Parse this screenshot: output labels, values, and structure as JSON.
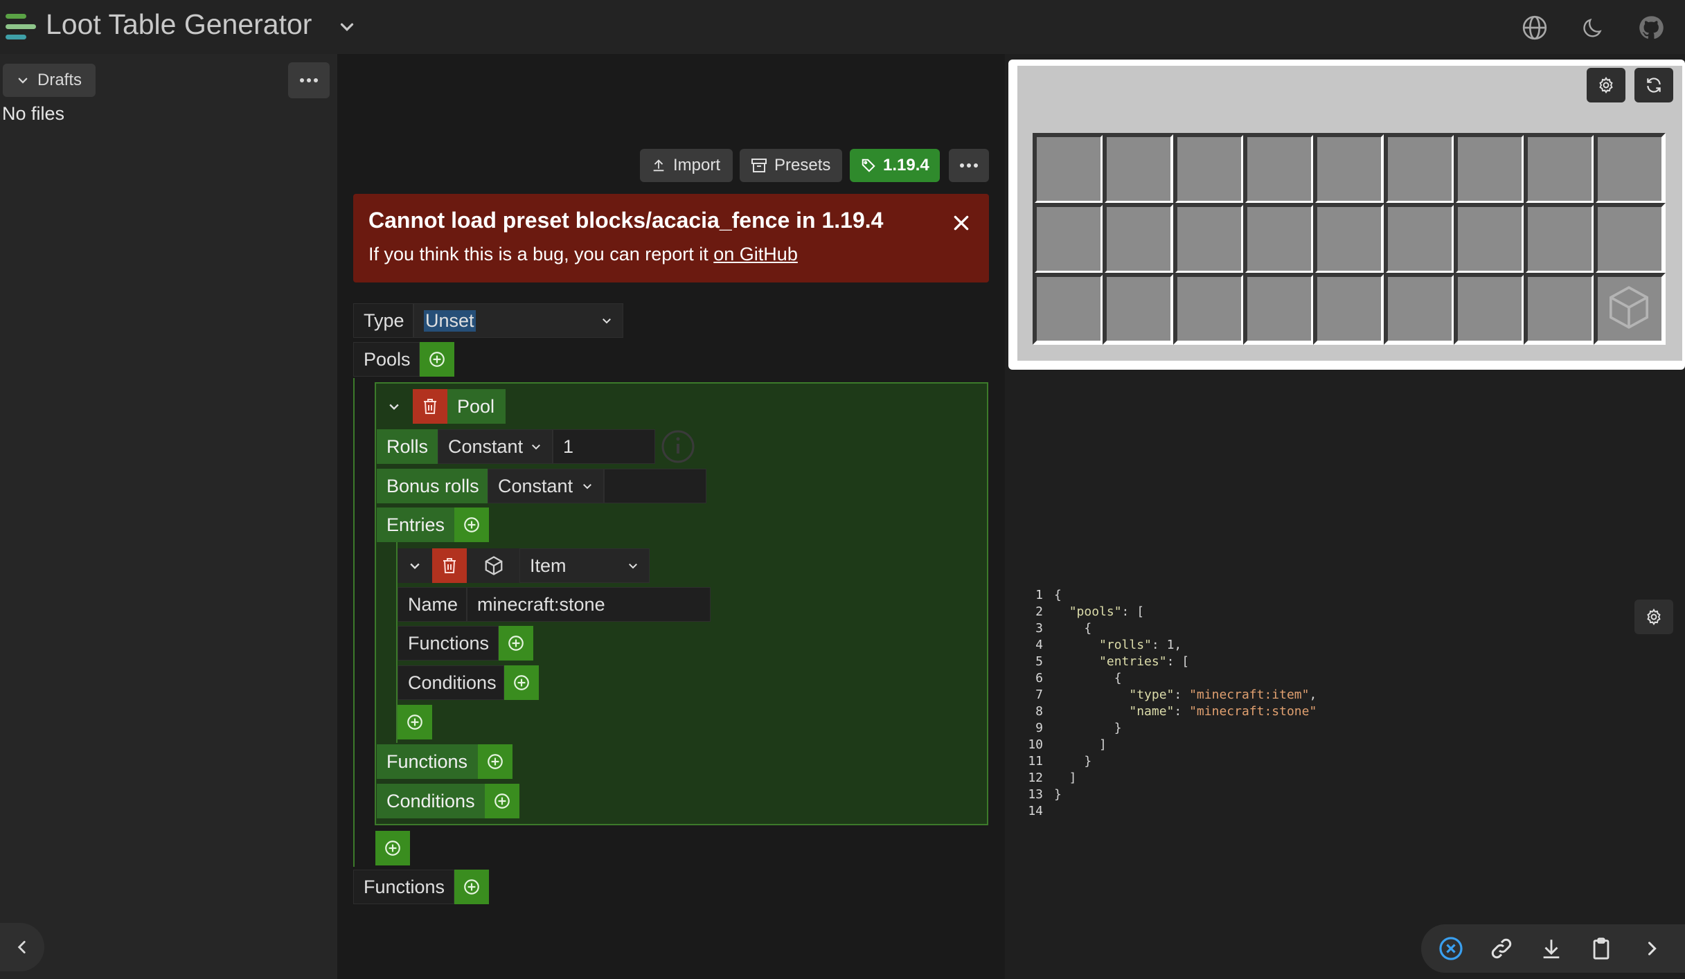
{
  "header": {
    "title": "Loot Table Generator",
    "icons": {
      "logo": "logo-bars-icon",
      "menu": "chevron-down-icon",
      "language": "globe-icon",
      "theme": "moon-icon",
      "github": "github-icon"
    }
  },
  "sidebar": {
    "drafts_label": "Drafts",
    "empty_text": "No files"
  },
  "toolbar": {
    "import_label": "Import",
    "presets_label": "Presets",
    "version_label": "1.19.4"
  },
  "error": {
    "title": "Cannot load preset blocks/acacia_fence in 1.19.4",
    "text_prefix": "If you think this is a bug, you can report it ",
    "link_text": "on GitHub"
  },
  "editor": {
    "type_label": "Type",
    "type_value": "Unset",
    "pools_label": "Pools",
    "pool_label": "Pool",
    "rolls_label": "Rolls",
    "rolls_mode": "Constant",
    "rolls_value": "1",
    "bonus_rolls_label": "Bonus rolls",
    "bonus_rolls_mode": "Constant",
    "bonus_rolls_value": "",
    "entries_label": "Entries",
    "entry_type": "Item",
    "name_label": "Name",
    "name_value": "minecraft:stone",
    "entry_functions_label": "Functions",
    "entry_conditions_label": "Conditions",
    "pool_functions_label": "Functions",
    "pool_conditions_label": "Conditions",
    "root_functions_label": "Functions"
  },
  "preview": {
    "rows": 3,
    "cols": 9
  },
  "code": {
    "lines": [
      "{",
      "  \"pools\": [",
      "    {",
      "      \"rolls\": 1,",
      "      \"entries\": [",
      "        {",
      "          \"type\": \"minecraft:item\",",
      "          \"name\": \"minecraft:stone\"",
      "        }",
      "      ]",
      "    }",
      "  ]",
      "}",
      ""
    ]
  },
  "colors": {
    "accent_green": "#3a8d1f",
    "delete_red": "#b2321f",
    "error_bg": "#6b1a10",
    "json_key": "#dcdcaa",
    "json_string": "#e0a070"
  }
}
